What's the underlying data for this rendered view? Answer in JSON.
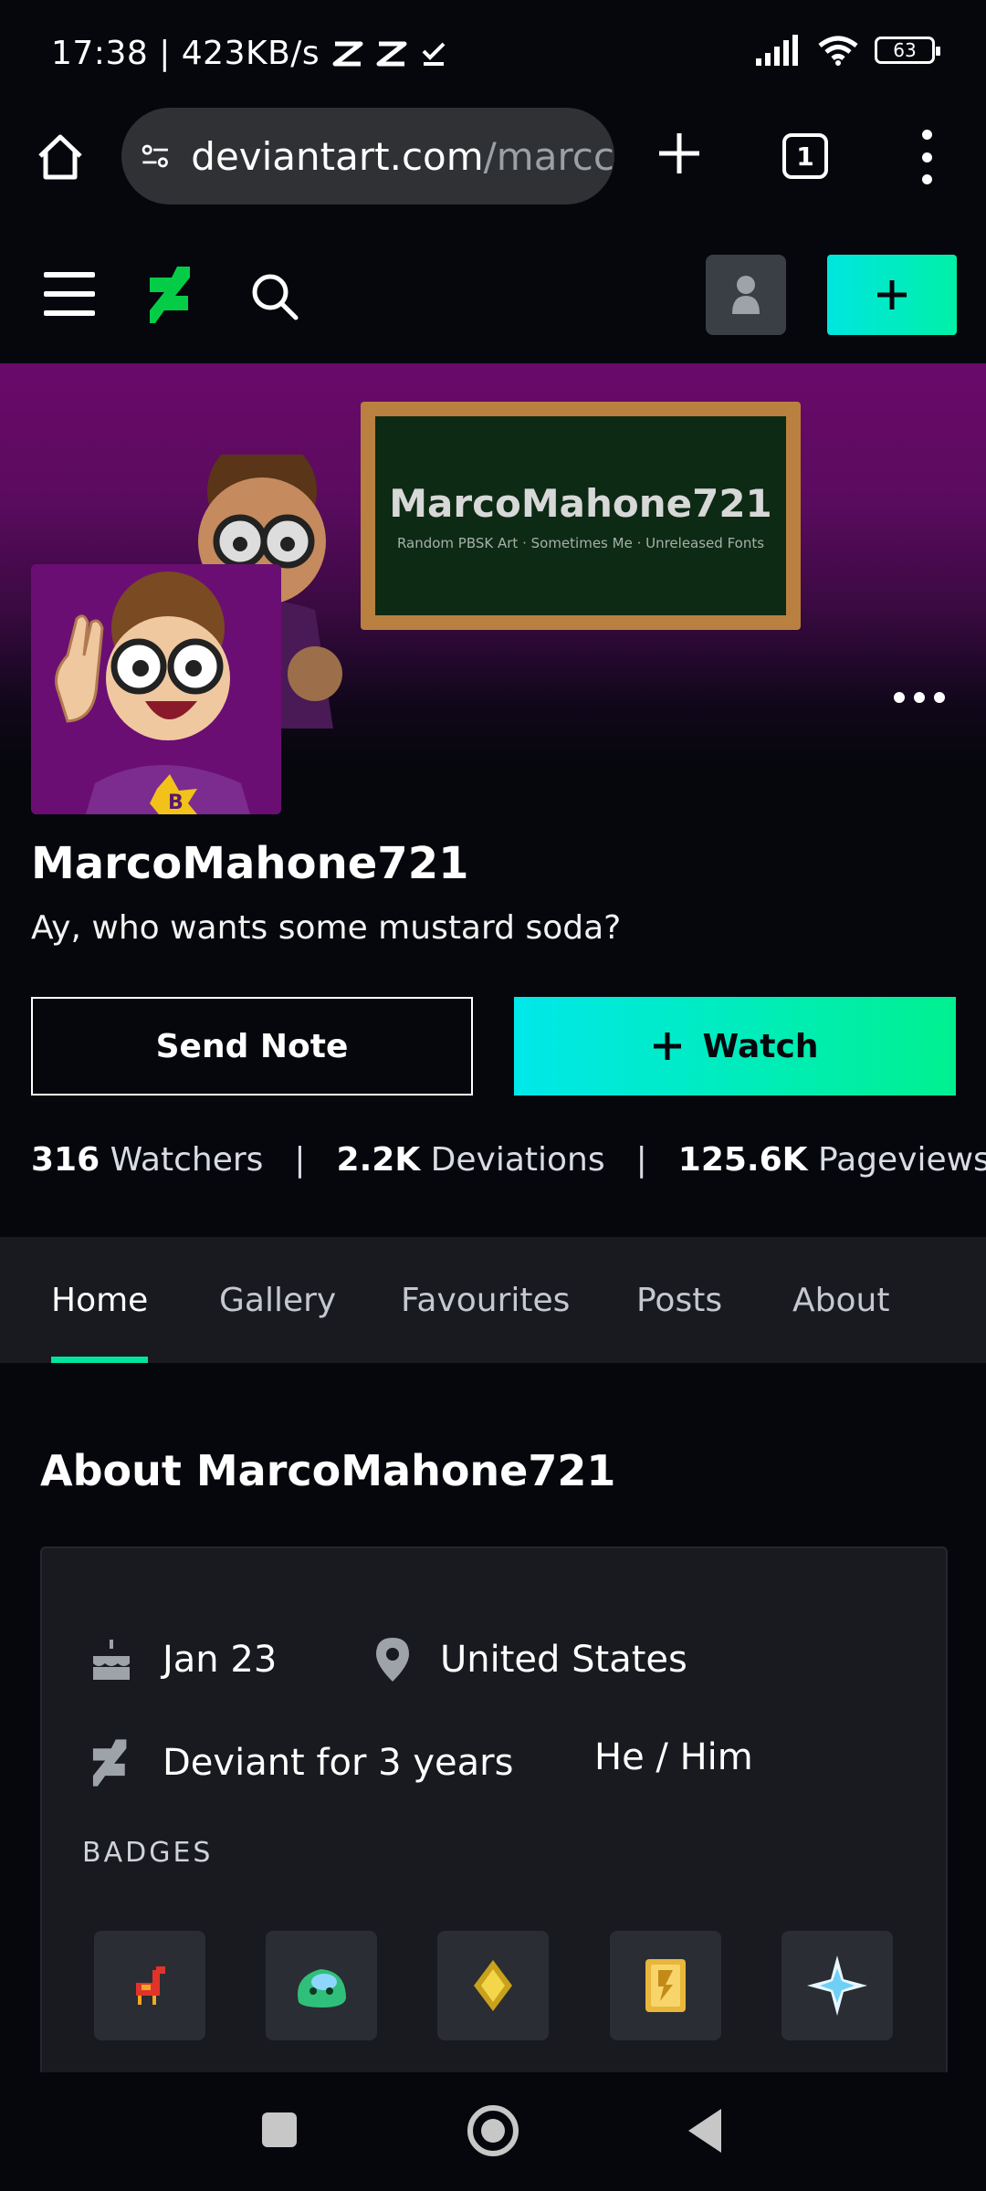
{
  "status": {
    "time_speed": "17:38 | 423KB/s",
    "battery": "63"
  },
  "browser": {
    "url_main": "deviantart.com",
    "url_path": "/marcc",
    "tab_count": "1"
  },
  "banner": {
    "board_title": "MarcoMahone721",
    "board_subtitle": "Random PBSK Art · Sometimes Me · Unreleased Fonts"
  },
  "profile": {
    "username": "MarcoMahone721",
    "tagline": "Ay, who wants some mustard soda?",
    "send_note_label": "Send Note",
    "watch_label": "Watch"
  },
  "stats": {
    "watchers_value": "316",
    "watchers_label": "Watchers",
    "deviations_value": "2.2K",
    "deviations_label": "Deviations",
    "pageviews_value": "125.6K",
    "pageviews_label": "Pageviews",
    "separator": "|"
  },
  "tabs": [
    {
      "label": "Home"
    },
    {
      "label": "Gallery"
    },
    {
      "label": "Favourites"
    },
    {
      "label": "Posts"
    },
    {
      "label": "About"
    }
  ],
  "about": {
    "title": "About MarcoMahone721",
    "birthday": "Jan 23",
    "location": "United States",
    "deviant_for": "Deviant for 3 years",
    "pronouns": "He / Him",
    "badges_label": "BADGES",
    "badges": [
      {
        "icon": "llama-icon"
      },
      {
        "icon": "blob-icon"
      },
      {
        "icon": "gem-icon"
      },
      {
        "icon": "core-card-icon"
      },
      {
        "icon": "sparkle-icon"
      }
    ]
  },
  "colors": {
    "accent": "#00e59b",
    "watch_gradient_start": "#00e8ea",
    "watch_gradient_end": "#00f090",
    "background": "#06070d",
    "card": "#181a1f"
  }
}
